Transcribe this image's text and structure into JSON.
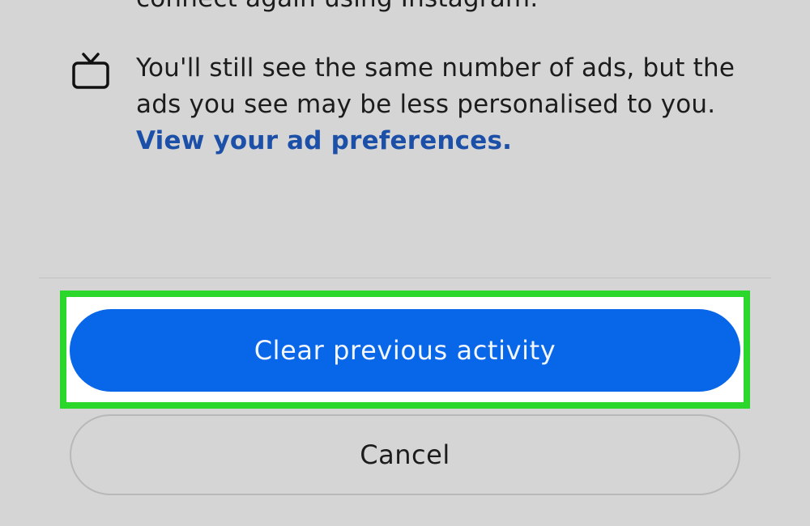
{
  "previous_item": {
    "text_tail": "connect again using Instagram."
  },
  "ads_info": {
    "icon": "tv-icon",
    "text": "You'll still see the same number of ads, but the ads you see may be less personalised to you.",
    "link_label": "View your ad preferences."
  },
  "actions": {
    "primary_label": "Clear previous activity",
    "secondary_label": "Cancel"
  },
  "colors": {
    "primary_button": "#0866e8",
    "link": "#1b4fa8",
    "highlight_border": "#2bd72b",
    "background": "#d5d5d5"
  }
}
